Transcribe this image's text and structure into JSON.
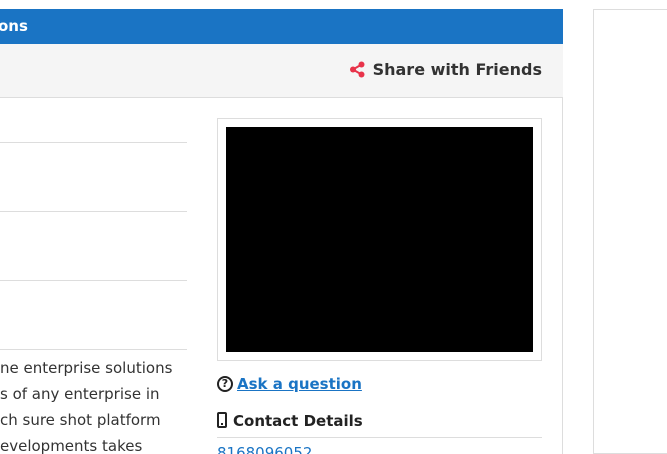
{
  "header": {
    "title": "ons"
  },
  "share": {
    "label": "Share with Friends",
    "icon": "share-icon",
    "icon_color": "#e8334a"
  },
  "description": {
    "lines": [
      "ne enterprise solutions",
      "s of any enterprise in",
      "ch sure shot platform",
      "evelopments takes"
    ]
  },
  "ask": {
    "label": " Ask a question",
    "icon": "question-circle-icon"
  },
  "contact": {
    "title": "Contact Details",
    "icon": "mobile-phone-icon",
    "phone": "8168096052"
  },
  "colors": {
    "header_bg": "#1a74c4",
    "link": "#1a74c4",
    "share_bar_bg": "#f5f5f5"
  }
}
